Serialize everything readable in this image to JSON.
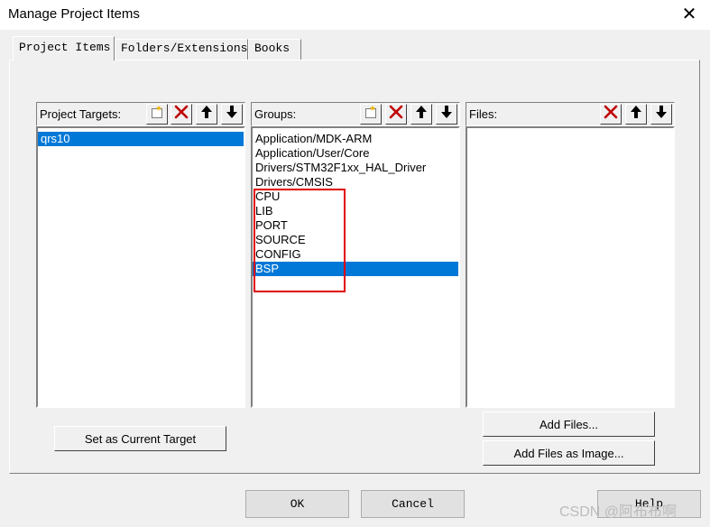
{
  "window": {
    "title": "Manage Project Items",
    "close_glyph": "✕"
  },
  "tabs": [
    {
      "label": "Project Items"
    },
    {
      "label": "Folders/Extensions"
    },
    {
      "label": "Books"
    }
  ],
  "targets": {
    "header": "Project Targets:",
    "items": [
      {
        "label": "qrs10",
        "selected": true
      }
    ]
  },
  "groups": {
    "header": "Groups:",
    "items": [
      {
        "label": "Application/MDK-ARM"
      },
      {
        "label": "Application/User/Core"
      },
      {
        "label": "Drivers/STM32F1xx_HAL_Driver"
      },
      {
        "label": "Drivers/CMSIS"
      },
      {
        "label": "CPU"
      },
      {
        "label": "LIB"
      },
      {
        "label": "PORT"
      },
      {
        "label": "SOURCE"
      },
      {
        "label": "CONFIG"
      },
      {
        "label": "BSP",
        "selected": true
      }
    ]
  },
  "files": {
    "header": "Files:",
    "items": []
  },
  "toolbar_icons": [
    "new-icon",
    "delete-icon",
    "move-up-icon",
    "move-down-icon"
  ],
  "buttons": {
    "set_current_target": "Set as Current Target",
    "add_files": "Add Files...",
    "add_files_as_image": "Add Files as Image...",
    "ok": "OK",
    "cancel": "Cancel",
    "help": "Help"
  },
  "annotation": {
    "color": "#e00000"
  },
  "watermark": "CSDN @阿布布啊",
  "colors": {
    "selection": "#0078d7",
    "dialog_bg": "#f0f0f0"
  }
}
